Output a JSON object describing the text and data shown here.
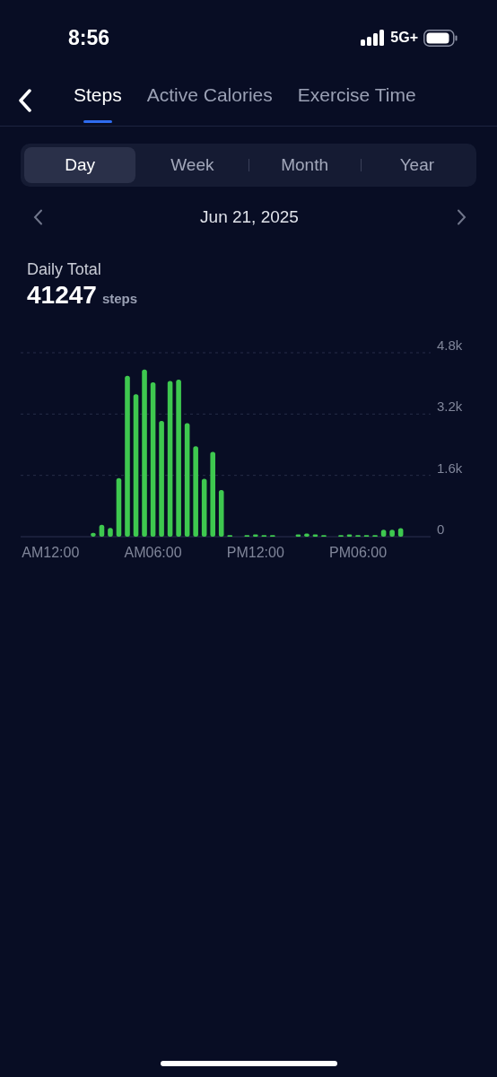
{
  "status_bar": {
    "time": "8:56",
    "network": "5G+"
  },
  "tabs": [
    {
      "label": "Steps",
      "selected": true
    },
    {
      "label": "Active Calories",
      "selected": false
    },
    {
      "label": "Exercise Time",
      "selected": false
    }
  ],
  "periods": [
    {
      "label": "Day",
      "selected": true
    },
    {
      "label": "Week",
      "selected": false
    },
    {
      "label": "Month",
      "selected": false
    },
    {
      "label": "Year",
      "selected": false
    }
  ],
  "date": "Jun 21, 2025",
  "summary": {
    "label": "Daily Total",
    "value": "41247",
    "unit": "steps"
  },
  "chart_data": {
    "type": "bar",
    "categories": [
      null,
      null,
      null,
      "AM12:00",
      null,
      null,
      null,
      null,
      null,
      null,
      null,
      null,
      null,
      null,
      null,
      "AM06:00",
      null,
      null,
      null,
      null,
      null,
      null,
      null,
      null,
      null,
      null,
      null,
      "PM12:00",
      null,
      null,
      null,
      null,
      null,
      null,
      null,
      null,
      null,
      null,
      null,
      "PM06:00",
      null,
      null,
      null,
      null,
      null,
      null,
      null,
      null
    ],
    "series": [
      {
        "color": "#3ec84f",
        "values": [
          null,
          null,
          null,
          null,
          null,
          null,
          null,
          null,
          100,
          310,
          230,
          1530,
          4200,
          3720,
          4360,
          4030,
          3020,
          4060,
          4100,
          2960,
          2360,
          1510,
          2210,
          1220,
          40,
          null,
          40,
          60,
          40,
          40,
          null,
          null,
          60,
          80,
          60,
          40,
          null,
          40,
          60,
          40,
          40,
          40,
          180,
          180,
          220,
          null,
          null,
          null
        ]
      }
    ],
    "ylim": [
      0,
      4800
    ],
    "yticks": [
      {
        "value": 0,
        "label": "0"
      },
      {
        "value": 1600,
        "label": "1.6k"
      },
      {
        "value": 3200,
        "label": "3.2k"
      },
      {
        "value": 4800,
        "label": "4.8k"
      }
    ]
  }
}
